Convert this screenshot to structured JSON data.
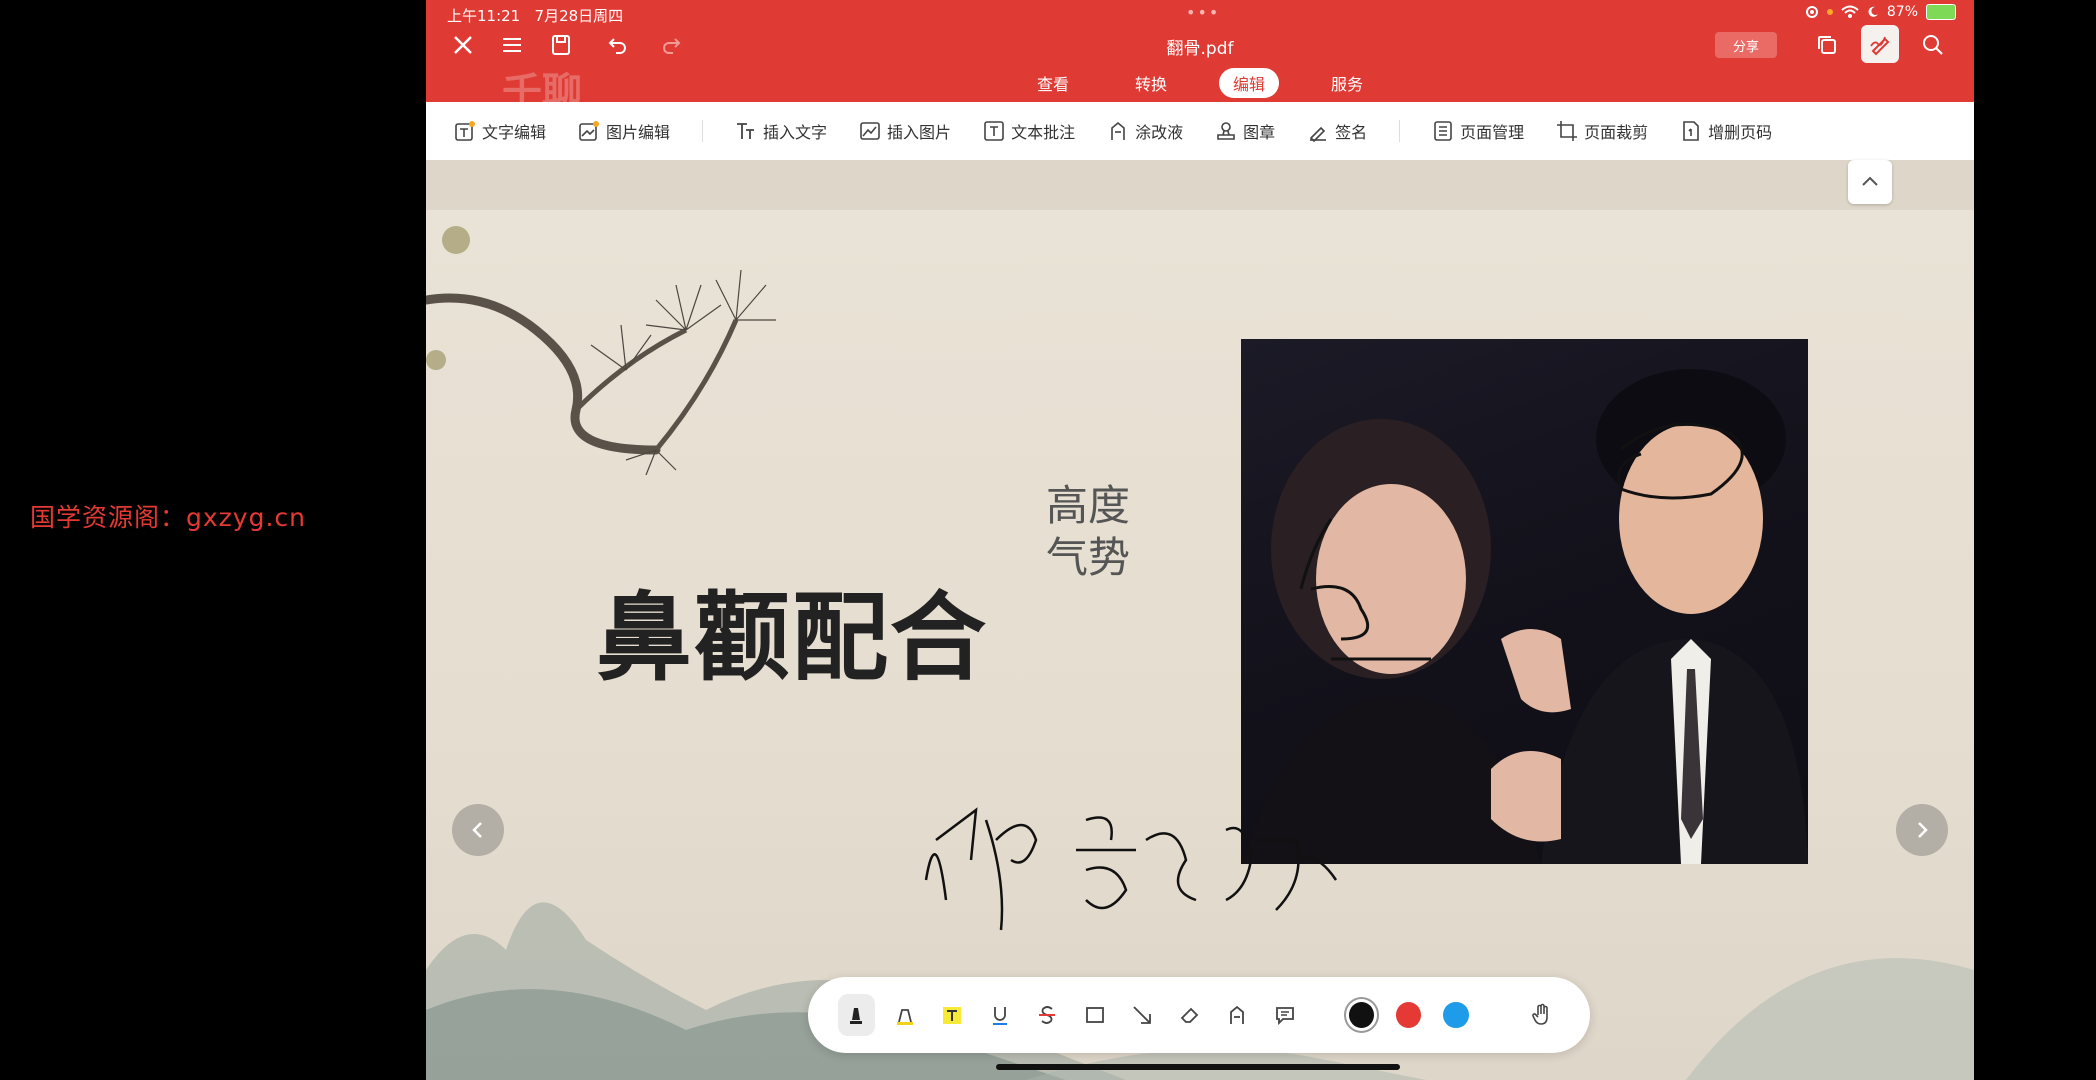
{
  "watermark": "国学资源阁：gxzyg.cn",
  "status": {
    "time": "上午11:21",
    "date": "7月28日周四",
    "battery": "87%"
  },
  "header": {
    "title": "翻骨.pdf",
    "share_label": "分享",
    "logo_text": "千聊",
    "tabs": [
      {
        "label": "查看",
        "active": false
      },
      {
        "label": "转换",
        "active": false
      },
      {
        "label": "编辑",
        "active": true
      },
      {
        "label": "服务",
        "active": false
      }
    ]
  },
  "toolbar": {
    "items": [
      {
        "label": "文字编辑",
        "icon": "text-edit-icon"
      },
      {
        "label": "图片编辑",
        "icon": "image-edit-icon"
      },
      {
        "label": "插入文字",
        "icon": "insert-text-icon"
      },
      {
        "label": "插入图片",
        "icon": "insert-image-icon"
      },
      {
        "label": "文本批注",
        "icon": "text-annotation-icon"
      },
      {
        "label": "涂改液",
        "icon": "correction-fluid-icon"
      },
      {
        "label": "图章",
        "icon": "stamp-icon"
      },
      {
        "label": "签名",
        "icon": "signature-icon"
      },
      {
        "label": "页面管理",
        "icon": "page-manage-icon"
      },
      {
        "label": "页面裁剪",
        "icon": "page-crop-icon"
      },
      {
        "label": "增删页码",
        "icon": "page-number-icon"
      }
    ]
  },
  "document": {
    "title": "鼻颧配合",
    "subtitle_lines": [
      "高度",
      "气势"
    ],
    "handwriting": "帅 家庭 驰"
  },
  "pen_bar": {
    "tools": [
      "marker-icon",
      "highlighter-icon",
      "text-highlight-icon",
      "underline-icon",
      "strikethrough-icon",
      "rectangle-icon",
      "arrow-icon",
      "eraser-icon",
      "fill-icon",
      "comment-icon"
    ],
    "colors": [
      "#111111",
      "#e53935",
      "#1e9be9"
    ],
    "selected_color": "#111111"
  }
}
